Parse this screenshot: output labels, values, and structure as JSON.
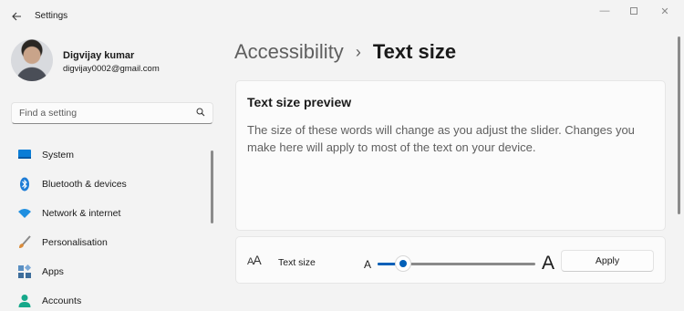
{
  "window": {
    "title": "Settings",
    "back_icon": "back-arrow-icon",
    "controls": {
      "minimize": "—",
      "close": "✕"
    }
  },
  "user": {
    "name": "Digvijay kumar",
    "email": "digvijay0002@gmail.com"
  },
  "search": {
    "placeholder": "Find a setting",
    "value": ""
  },
  "sidebar": {
    "items": [
      {
        "label": "System",
        "icon": "monitor-icon",
        "color": "#0a7dd6"
      },
      {
        "label": "Bluetooth & devices",
        "icon": "bluetooth-icon",
        "color": "#1d7cd6"
      },
      {
        "label": "Network & internet",
        "icon": "wifi-icon",
        "color": "#1f8fe0"
      },
      {
        "label": "Personalisation",
        "icon": "paintbrush-icon",
        "color": "#d98b3a"
      },
      {
        "label": "Apps",
        "icon": "apps-icon",
        "color": "#3d6d9b"
      },
      {
        "label": "Accounts",
        "icon": "person-icon",
        "color": "#16a88a"
      }
    ]
  },
  "breadcrumb": {
    "parent": "Accessibility",
    "separator": "›",
    "current": "Text size"
  },
  "preview": {
    "title": "Text size preview",
    "text": "The size of these words will change as you adjust the slider. Changes you make here will apply to most of the text on your device."
  },
  "text_size": {
    "icon_small": "A",
    "icon_large": "A",
    "label": "Text size",
    "slider_min_label": "A",
    "slider_max_label": "A",
    "slider_fraction": 0.16,
    "apply_label": "Apply"
  },
  "colors": {
    "accent": "#005fb8",
    "background": "#f3f3f3",
    "card": "#fbfbfb"
  }
}
